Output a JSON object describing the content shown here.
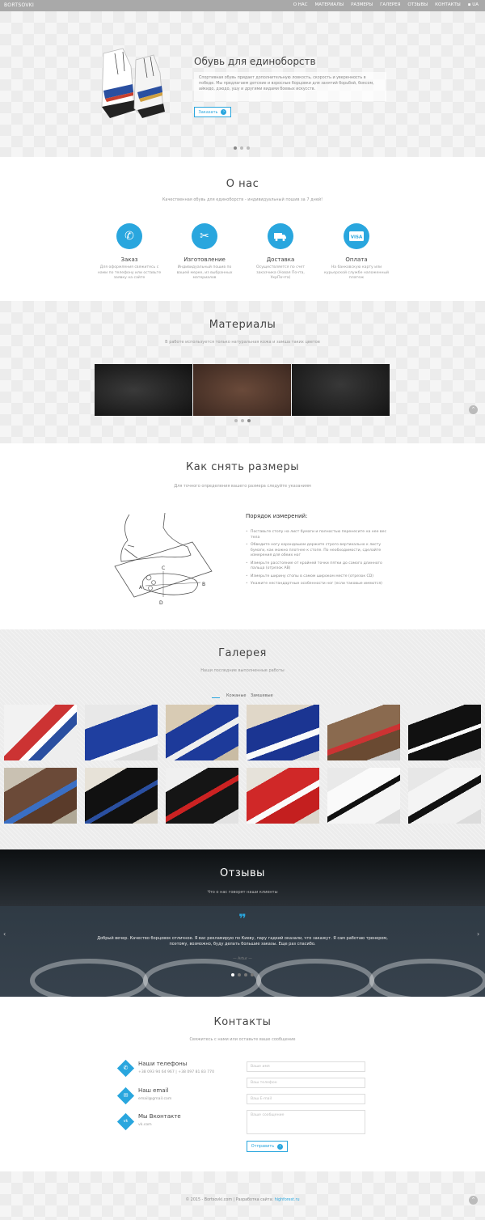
{
  "nav": {
    "logo": "BORTSOVKI",
    "items": [
      "О нас",
      "Материалы",
      "Размеры",
      "Галерея",
      "Отзывы",
      "Контакты",
      "UA"
    ]
  },
  "hero": {
    "title": "Обувь для единоборств",
    "text": "Спортивная обувь придает дополнительную ловкость, скорость и уверенность в победе. Мы предлагаем детские и взрослые борцовки для занятий борьбой, боксом, айкидо, дзюдо, ушу и другими видами боевых искусств.",
    "button": "Заказать"
  },
  "about": {
    "title": "О нас",
    "subtitle": "Качественная обувь для единоборств - индивидуальный пошив за 7 дней!",
    "features": [
      {
        "icon": "phone-icon",
        "title": "Заказ",
        "text": "Для оформления свяжитесь с нами по телефону или оставьте заявку на сайте"
      },
      {
        "icon": "scissors-icon",
        "title": "Изготовление",
        "text": "Индивидуальный пошив по вашей мерке, из выбранных материалов"
      },
      {
        "icon": "truck-icon",
        "title": "Доставка",
        "text": "Осуществляется по счет заказчика (Новая Почта, УкрПочта)"
      },
      {
        "icon": "visa-icon",
        "title": "Оплата",
        "text": "На банковскую карту или курьерской службе наложенный платеж"
      }
    ]
  },
  "materials": {
    "title": "Материалы",
    "subtitle": "В работе используется только натуральная кожа и замша таких цветов"
  },
  "sizes": {
    "title": "Как снять размеры",
    "subtitle": "Для точного определения вашего размера следуйте указаниям",
    "list_title": "Порядок измерений:",
    "steps": [
      "Поставьте стопу на лист бумаги и полностью перенесите на нее вес тела",
      "Обведите ногу карандашом держите строго вертикально к листу бумаги, как можно плотнее к стопе. По необходимости, сделайте измерения для обеих ног",
      "Измерьте расстояние от крайней точки пятки до самого длинного пальца (отрезок AB)",
      "Измерьте ширину стопы в самом широком месте (отрезок CD)",
      "Укажите нестандартные особенности ног (если таковые имеются)"
    ],
    "labels": [
      "C",
      "A",
      "B",
      "D"
    ]
  },
  "gallery": {
    "title": "Галерея",
    "subtitle": "Наши последние выполненные работы",
    "filters": [
      "",
      "Кожаные",
      "Замшевые"
    ]
  },
  "reviews": {
    "title": "Отзывы",
    "subtitle": "Что о нас говорят наши клиенты",
    "text": "Добрый вечер. Качество борцовок отличное. Я вас рекламирую по Киеву, пару гадкий оказали, что закажут. Я сам работаю тренером, поэтому, возможно, буду делать большие заказы. Еще раз спасибо.",
    "author": "— Artur —"
  },
  "contacts": {
    "title": "Контакты",
    "subtitle": "Свяжитесь с нами или оставьте ваше сообщение",
    "items": [
      {
        "icon": "phone-icon",
        "title": "Наши телефоны",
        "value": "+38 093 94 64 967 | +38 097 81 83 770"
      },
      {
        "icon": "email-icon",
        "title": "Наш email",
        "value": "email@gmail.com"
      },
      {
        "icon": "vk-icon",
        "title": "Мы Вконтакте",
        "value": "vk.com"
      }
    ],
    "form": {
      "name_placeholder": "Ваше имя",
      "phone_placeholder": "Ваш телефон",
      "email_placeholder": "Ваш E-mail",
      "message_placeholder": "Ваше сообщение",
      "submit": "Отправить"
    }
  },
  "footer": {
    "copyright": "© 2015 - Bortsovki.com | Разработка сайта: ",
    "credit": "highforest.ru"
  }
}
